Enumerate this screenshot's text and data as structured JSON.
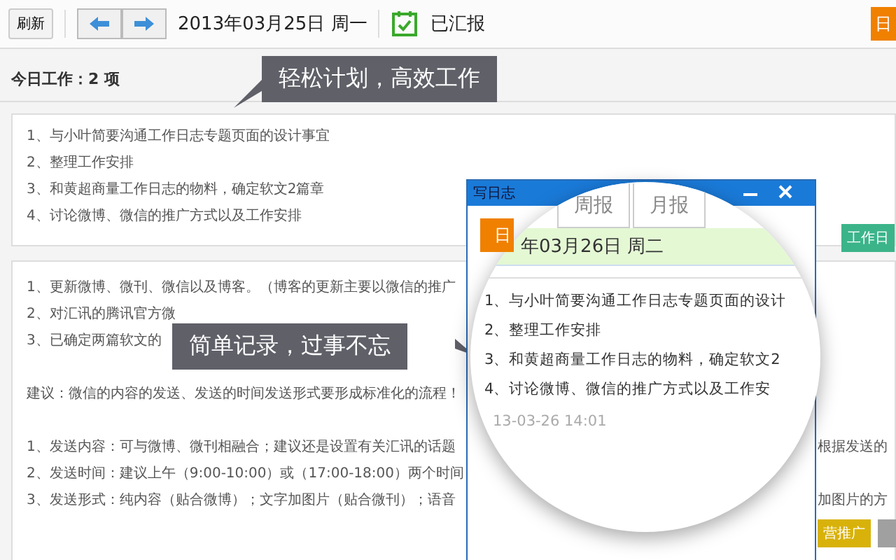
{
  "toolbar": {
    "refresh": "刷新",
    "date": "2013年03月25日 周一",
    "status": "已汇报",
    "right_button": "日"
  },
  "today_heading": "今日工作：2 项",
  "callouts": [
    {
      "text": "轻松计划，高效工作"
    },
    {
      "text": "简单记录，过事不忘"
    }
  ],
  "plan_card": {
    "items": [
      "1、与小叶简要沟通工作日志专题页面的设计事宜",
      "2、整理工作安排",
      "3、和黄超商量工作日志的物料，确定软文2篇章",
      "4、讨论微博、微信的推广方式以及工作安排"
    ],
    "tag": "工作日"
  },
  "log_card": {
    "rows": [
      {
        "left": "1、更新微博、微刊、微信以及博客。（博客的更新主要以微信的推广"
      },
      {
        "left": "2、对汇讯的腾讯官方微"
      },
      {
        "left": "3、已确定两篇软文的"
      },
      {
        "left": "建议：微信的内容的发送、发送的时间发送形式要形成标准化的流程！"
      },
      {
        "left": "1、发送内容：可与微博、微刊相融合；建议还是设置有关汇讯的话题",
        "right": "根据发送的"
      },
      {
        "left": "2、发送时间：建议上午（9:00-10:00）或（17:00-18:00）两个时间"
      },
      {
        "left": "3、发送形式：纯内容（贴合微博）；文字加图片（贴合微刊）；语音",
        "right": "加图片的方"
      }
    ],
    "tags": [
      {
        "label": "营推广",
        "color": "#d8b20a"
      },
      {
        "color": "#a0a0a0"
      }
    ]
  },
  "popup": {
    "title": "写日志",
    "tabs": [
      {
        "label": "日",
        "selected": true
      },
      {
        "label": "周报",
        "selected": false
      },
      {
        "label": "月报",
        "selected": false
      }
    ],
    "date": "年03月26日  周二",
    "items": [
      "1、与小叶简要沟通工作日志专题页面的设计",
      "2、整理工作安排",
      "3、和黄超商量工作日志的物料，确定软文2",
      "4、讨论微博、微信的推广方式以及工作安"
    ],
    "time": "13-03-26 14:01"
  }
}
